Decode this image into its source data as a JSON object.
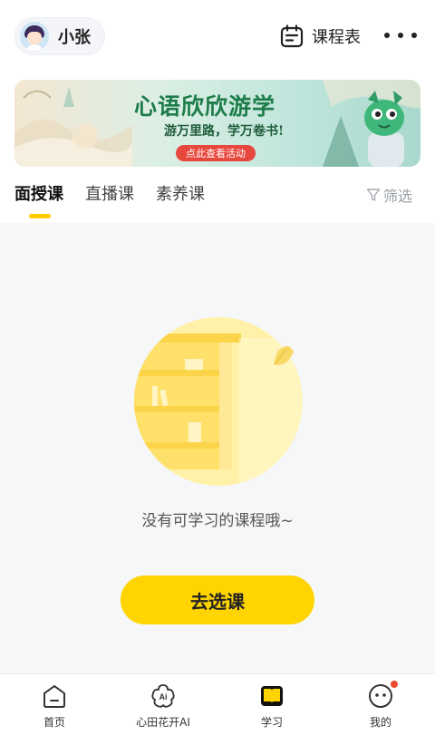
{
  "header": {
    "user_name": "小张",
    "schedule_label": "课程表"
  },
  "banner": {
    "title": "心语欣欣游学",
    "subtitle": "游万里路，学万卷书!",
    "button_label": "点此查看活动"
  },
  "tabs": [
    {
      "label": "面授课",
      "active": true
    },
    {
      "label": "直播课",
      "active": false
    },
    {
      "label": "素养课",
      "active": false
    }
  ],
  "filter_label": "筛选",
  "empty": {
    "text": "没有可学习的课程哦~",
    "button_label": "去选课"
  },
  "bottom_nav": [
    {
      "label": "首页",
      "icon": "home-icon"
    },
    {
      "label": "心田花开AI",
      "icon": "ai-flower-icon"
    },
    {
      "label": "学习",
      "icon": "book-icon",
      "active": true
    },
    {
      "label": "我的",
      "icon": "profile-icon",
      "badge": true
    }
  ],
  "colors": {
    "accent": "#ffd400",
    "indicator": "#ffcc00",
    "badge": "#f04a2f",
    "banner_title": "#1e7d4a",
    "banner_button": "#e8473d"
  }
}
